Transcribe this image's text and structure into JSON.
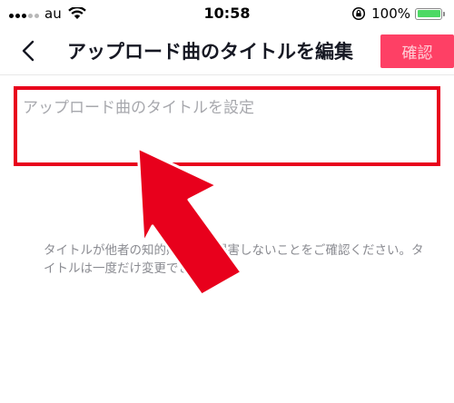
{
  "status_bar": {
    "carrier": "au",
    "time": "10:58",
    "battery_percent": "100%",
    "battery_level": 1.0,
    "icons": [
      "signal-dots-icon",
      "wifi-icon",
      "rotation-lock-icon",
      "battery-icon"
    ]
  },
  "nav": {
    "back_icon": "chevron-left-icon",
    "title": "アップロード曲のタイトルを編集",
    "confirm_label": "確認"
  },
  "title_field": {
    "value": "",
    "placeholder": "アップロード曲のタイトルを設定"
  },
  "helper_text": "タイトルが他者の知的財産権を侵害しないことをご確認ください。タイトルは一度だけ変更できます。",
  "colors": {
    "accent": "#fe2c55",
    "annotation": "#e8001c",
    "battery": "#4cd964"
  }
}
